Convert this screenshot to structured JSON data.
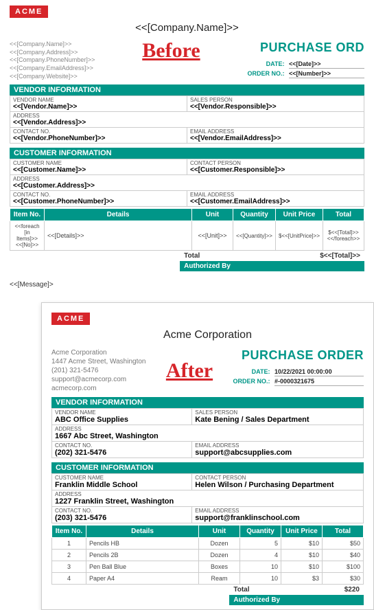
{
  "before": {
    "acme_badge": "ACME",
    "company_title": "<<[Company.Name]>>",
    "company_lines": [
      "<<[Company.Name]>>",
      "<<[Company.Address]>>",
      "<<[Company.PhoneNumber]>>",
      "<<[Company.EmailAddress]>>",
      "<<[Company.Website]>>"
    ],
    "po_label": "PURCHASE ORD",
    "ba_label": "Before",
    "date_label": "DATE:",
    "orderno_label": "ORDER NO.:",
    "date_value": "<<[Date]>>",
    "orderno_value": "<<[Number]>>",
    "vendor_banner": "VENDOR INFORMATION",
    "customer_banner": "CUSTOMER INFORMATION",
    "labels": {
      "vendor_name": "VENDOR NAME",
      "sales_person": "SALES PERSON",
      "address": "ADDRESS",
      "contact_no": "CONTACT NO.",
      "email": "EMAIL ADDRESS",
      "customer_name": "CUSTOMER NAME",
      "contact_person": "CONTACT PERSON"
    },
    "vendor": {
      "name": "<<[Vendor.Name]>>",
      "sales": "<<[Vendor.Responsible]>>",
      "address": "<<[Vendor.Address]>>",
      "contact": "<<[Vendor.PhoneNumber]>>",
      "email": "<<[Vendor.EmailAddress]>>"
    },
    "customer": {
      "name": "<<[Customer.Name]>>",
      "contact_person": "<<[Customer.Responsible]>>",
      "address": "<<[Customer.Address]>>",
      "contact": "<<[Customer.PhoneNumber]>>",
      "email": "<<[Customer.EmailAddress]>>"
    },
    "items_header": {
      "itemno": "Item No.",
      "details": "Details",
      "unit": "Unit",
      "qty": "Quantity",
      "price": "Unit Price",
      "total": "Total"
    },
    "item_row": {
      "itemno": "<<foreach [in Items]>><<[No]>>",
      "details": "<<[Details]>>",
      "unit": "<<[Unit]>>",
      "qty": "<<[Quantity]>>",
      "price": "$<<[UnitPrice]>>",
      "total": "$<<[Total]>><</foreach>>"
    },
    "total_label": "Total",
    "total_value": "$<<[Total]>>",
    "auth_label": "Authorized By",
    "message": "<<[Message]>"
  },
  "after": {
    "acme_badge": "ACME",
    "company_title": "Acme Corporation",
    "company_lines": [
      "Acme Corporation",
      "1447 Acme Street, Washington",
      "(201) 321-5476",
      "support@acmecorp.com",
      "acmecorp.com"
    ],
    "po_label": "PURCHASE ORDER",
    "ba_label": "After",
    "date_label": "DATE:",
    "orderno_label": "ORDER NO.:",
    "date_value": "10/22/2021 00:00:00",
    "orderno_value": "#-0000321675",
    "vendor_banner": "VENDOR INFORMATION",
    "customer_banner": "CUSTOMER INFORMATION",
    "labels": {
      "vendor_name": "VENDOR NAME",
      "sales_person": "SALES PERSON",
      "address": "ADDRESS",
      "contact_no": "CONTACT NO.",
      "email": "EMAIL ADDRESS",
      "customer_name": "CUSTOMER NAME",
      "contact_person": "CONTACT PERSON"
    },
    "vendor": {
      "name": "ABC Office Supplies",
      "sales": "Kate Bening / Sales Department",
      "address": "1667 Abc Street, Washington",
      "contact": "(202) 321-5476",
      "email": "support@abcsupplies.com"
    },
    "customer": {
      "name": "Franklin Middle School",
      "contact_person": "Helen Wilson / Purchasing Department",
      "address": "1227 Franklin Street, Washington",
      "contact": "(203) 321-5476",
      "email": "support@franklinschool.com"
    },
    "items_header": {
      "itemno": "Item No.",
      "details": "Details",
      "unit": "Unit",
      "qty": "Quantity",
      "price": "Unit Price",
      "total": "Total"
    },
    "items": [
      {
        "no": "1",
        "details": "Pencils HB",
        "unit": "Dozen",
        "qty": "5",
        "price": "$10",
        "total": "$50"
      },
      {
        "no": "2",
        "details": "Pencils 2B",
        "unit": "Dozen",
        "qty": "4",
        "price": "$10",
        "total": "$40"
      },
      {
        "no": "3",
        "details": "Pen Ball Blue",
        "unit": "Boxes",
        "qty": "10",
        "price": "$10",
        "total": "$100"
      },
      {
        "no": "4",
        "details": "Paper A4",
        "unit": "Ream",
        "qty": "10",
        "price": "$3",
        "total": "$30"
      }
    ],
    "total_label": "Total",
    "total_value": "$220",
    "auth_label": "Authorized By"
  },
  "chart_data": {
    "type": "table",
    "title": "Purchase Order Items (After)",
    "columns": [
      "Item No.",
      "Details",
      "Unit",
      "Quantity",
      "Unit Price",
      "Total"
    ],
    "rows": [
      [
        1,
        "Pencils HB",
        "Dozen",
        5,
        10,
        50
      ],
      [
        2,
        "Pencils 2B",
        "Dozen",
        4,
        10,
        40
      ],
      [
        3,
        "Pen Ball Blue",
        "Boxes",
        10,
        10,
        100
      ],
      [
        4,
        "Paper A4",
        "Ream",
        10,
        3,
        30
      ]
    ],
    "grand_total": 220,
    "currency": "$"
  }
}
